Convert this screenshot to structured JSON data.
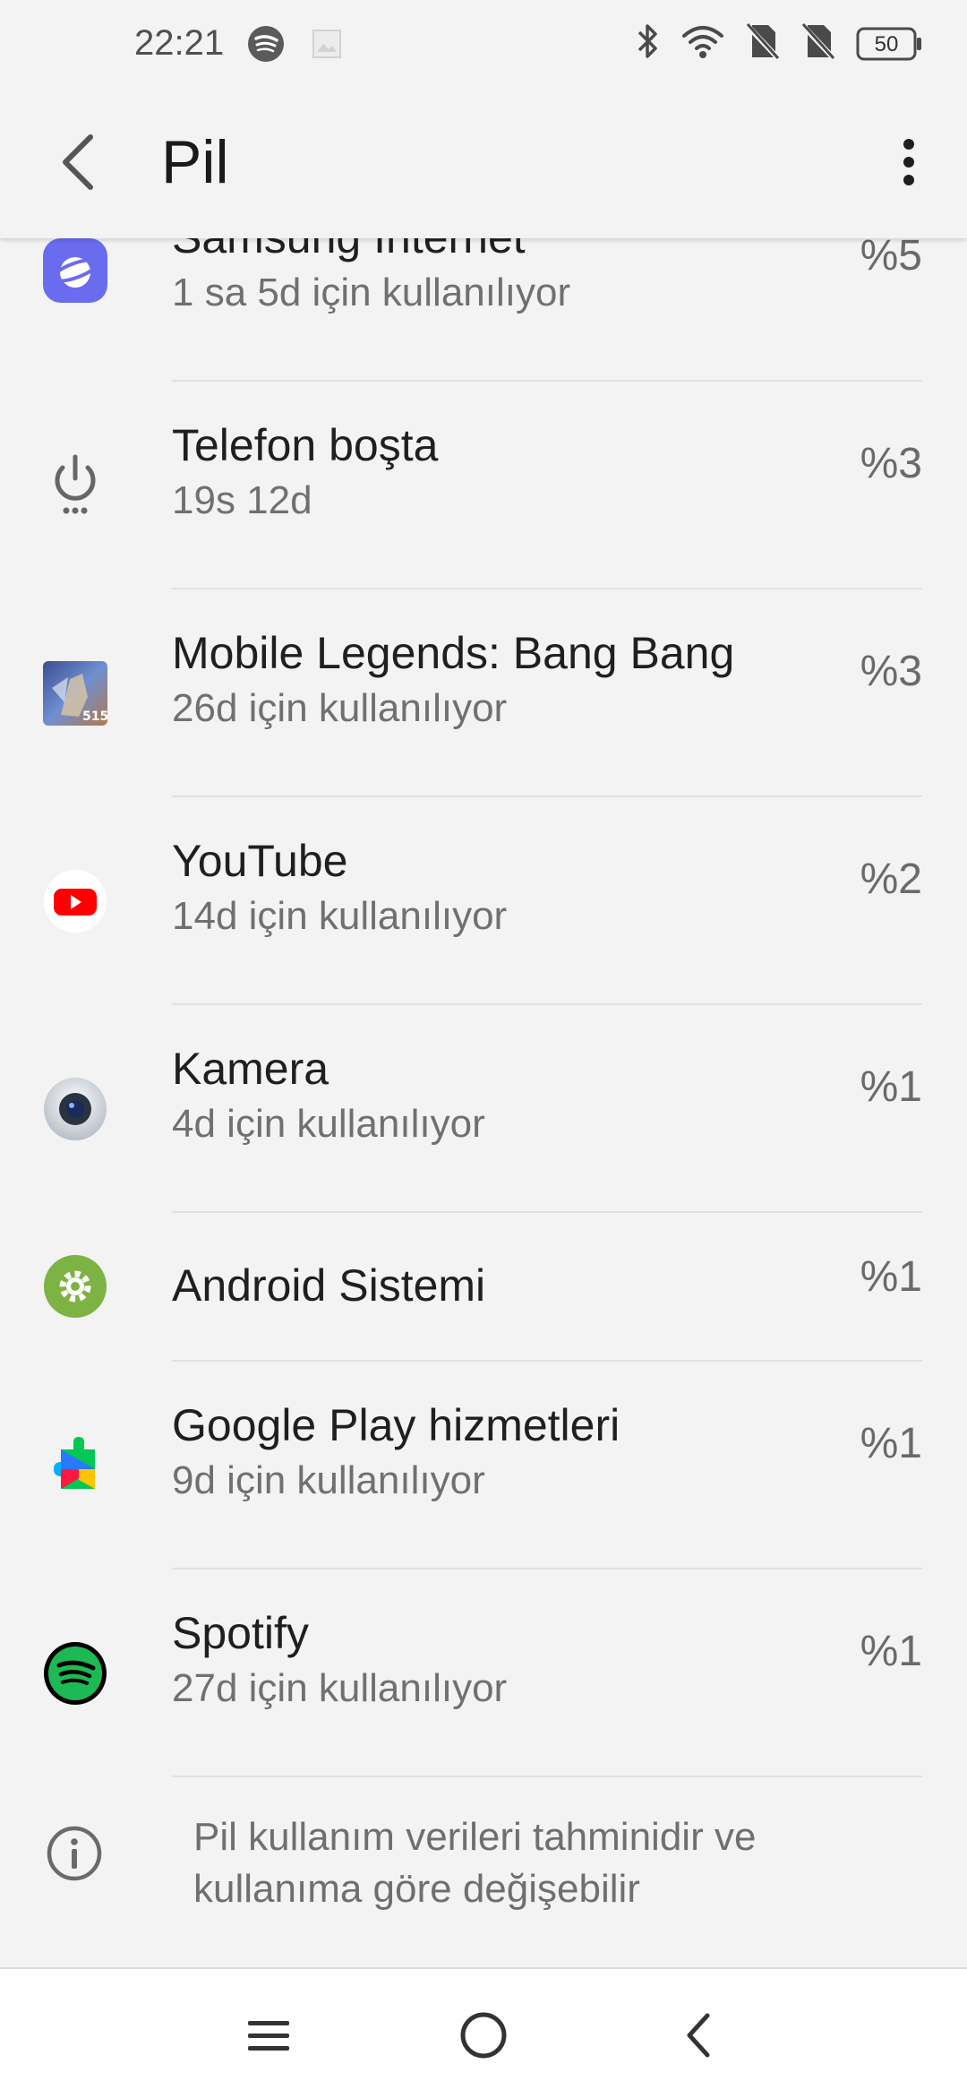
{
  "status_bar": {
    "time": "22:21",
    "battery_level": "50",
    "left_icons": [
      "spotify-icon",
      "image-icon"
    ],
    "right_icons": [
      "bluetooth-icon",
      "wifi-icon",
      "no-sim-icon",
      "no-sim-icon",
      "battery-icon"
    ]
  },
  "app_bar": {
    "title": "Pil",
    "back_icon": "chevron-left-icon",
    "menu_icon": "more-vert-icon"
  },
  "apps": [
    {
      "name": "Samsung Internet",
      "usage": "1 sa 5d için kullanılıyor",
      "percent": "%5",
      "icon": "samsung-internet-icon"
    },
    {
      "name": "Telefon boşta",
      "usage": "19s 12d",
      "percent": "%3",
      "icon": "power-idle-icon"
    },
    {
      "name": "Mobile Legends: Bang Bang",
      "usage": "26d için kullanılıyor",
      "percent": "%3",
      "icon": "mobile-legends-icon"
    },
    {
      "name": "YouTube",
      "usage": "14d için kullanılıyor",
      "percent": "%2",
      "icon": "youtube-icon"
    },
    {
      "name": "Kamera",
      "usage": "4d için kullanılıyor",
      "percent": "%1",
      "icon": "camera-icon"
    },
    {
      "name": "Android Sistemi",
      "usage": "",
      "percent": "%1",
      "icon": "android-system-icon"
    },
    {
      "name": "Google Play hizmetleri",
      "usage": "9d için kullanılıyor",
      "percent": "%1",
      "icon": "google-play-services-icon"
    },
    {
      "name": "Spotify",
      "usage": "27d için kullanılıyor",
      "percent": "%1",
      "icon": "spotify-icon"
    }
  ],
  "footer": {
    "note": "Pil kullanım verileri tahminidir ve kullanıma göre değişebilir",
    "icon": "info-icon"
  },
  "nav_bar": {
    "buttons": [
      "menu-icon",
      "home-icon",
      "back-icon"
    ]
  },
  "colors": {
    "background": "#f3f3f3",
    "samsung_internet": "#6a6cf0",
    "youtube_red": "#ff0000",
    "android_green": "#7cb342",
    "spotify_green": "#1db954"
  }
}
